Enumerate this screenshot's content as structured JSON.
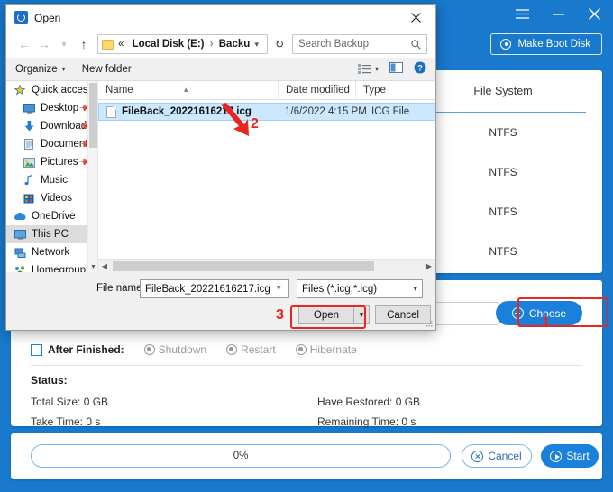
{
  "app": {
    "titlebar": {
      "menu_icon": "hamburger-menu-icon",
      "minimize_icon": "minimize-icon",
      "close_icon": "close-icon"
    },
    "make_boot_disk": "Make Boot Disk",
    "table": {
      "column_header": "File System",
      "file_systems": [
        "NTFS",
        "NTFS",
        "NTFS",
        "NTFS"
      ]
    },
    "path_input": {
      "value": "",
      "placeholder": ""
    },
    "choose_button": "Choose",
    "after_finished": {
      "label": "After Finished:",
      "checked": false,
      "options": [
        "Shutdown",
        "Restart",
        "Hibernate"
      ]
    },
    "status": {
      "heading": "Status:",
      "total_size": "Total Size: 0 GB",
      "have_restored": "Have Restored: 0 GB",
      "take_time": "Take Time: 0 s",
      "remaining_time": "Remaining Time: 0 s"
    },
    "bottom": {
      "progress_text": "0%",
      "progress_percent": 0,
      "cancel": "Cancel",
      "start": "Start"
    },
    "colors": {
      "brand_blue": "#1879cd",
      "button_blue": "#1b80db",
      "annotation_red": "#e8251f"
    }
  },
  "dialog": {
    "title": "Open",
    "close_icon": "close-icon",
    "nav": {
      "back_icon": "arrow-left-icon",
      "forward_icon": "arrow-right-icon",
      "recent_icon": "chevron-down-icon",
      "up_icon": "arrow-up-icon",
      "address": {
        "chevrons": "«",
        "crumb1": "Local Disk (E:)",
        "separator": "›",
        "crumb2": "Backup",
        "dropdown_icon": "chevron-down-icon"
      },
      "refresh_icon": "refresh-icon",
      "search": {
        "placeholder": "Search Backup",
        "value": "",
        "icon": "search-icon"
      }
    },
    "toolbar": {
      "organize": "Organize",
      "new_folder": "New folder",
      "view_icon": "list-view-icon",
      "preview_icon": "preview-pane-icon",
      "help_icon": "help-icon"
    },
    "sidebar": [
      {
        "label": "Quick access",
        "icon": "star-icon",
        "indent": false,
        "pinned": false,
        "selected": false
      },
      {
        "label": "Desktop",
        "icon": "desktop-icon",
        "indent": true,
        "pinned": true,
        "selected": false
      },
      {
        "label": "Downloads",
        "icon": "download-icon",
        "indent": true,
        "pinned": true,
        "selected": false
      },
      {
        "label": "Documents",
        "icon": "documents-icon",
        "indent": true,
        "pinned": true,
        "selected": false
      },
      {
        "label": "Pictures",
        "icon": "pictures-icon",
        "indent": true,
        "pinned": true,
        "selected": false
      },
      {
        "label": "Music",
        "icon": "music-icon",
        "indent": true,
        "pinned": false,
        "selected": false
      },
      {
        "label": "Videos",
        "icon": "videos-icon",
        "indent": true,
        "pinned": false,
        "selected": false
      },
      {
        "label": "OneDrive",
        "icon": "cloud-icon",
        "indent": false,
        "pinned": false,
        "selected": false
      },
      {
        "label": "This PC",
        "icon": "this-pc-icon",
        "indent": false,
        "pinned": false,
        "selected": true
      },
      {
        "label": "Network",
        "icon": "network-icon",
        "indent": false,
        "pinned": false,
        "selected": false
      },
      {
        "label": "Homegroup",
        "icon": "homegroup-icon",
        "indent": false,
        "pinned": false,
        "selected": false
      }
    ],
    "columns": {
      "name": "Name",
      "date_modified": "Date modified",
      "type": "Type"
    },
    "files": [
      {
        "name": "FileBack_20221616217.icg",
        "date": "1/6/2022 4:15 PM",
        "type": "ICG File",
        "selected": true
      }
    ],
    "footer": {
      "file_name_label": "File name:",
      "file_name_value": "FileBack_20221616217.icg",
      "file_type_value": "Files (*.icg,*.icg)",
      "open_button": "Open",
      "open_split_icon": "caret-down-icon",
      "cancel_button": "Cancel"
    }
  },
  "annotations": {
    "step1": "1",
    "step2": "2",
    "step3": "3"
  }
}
